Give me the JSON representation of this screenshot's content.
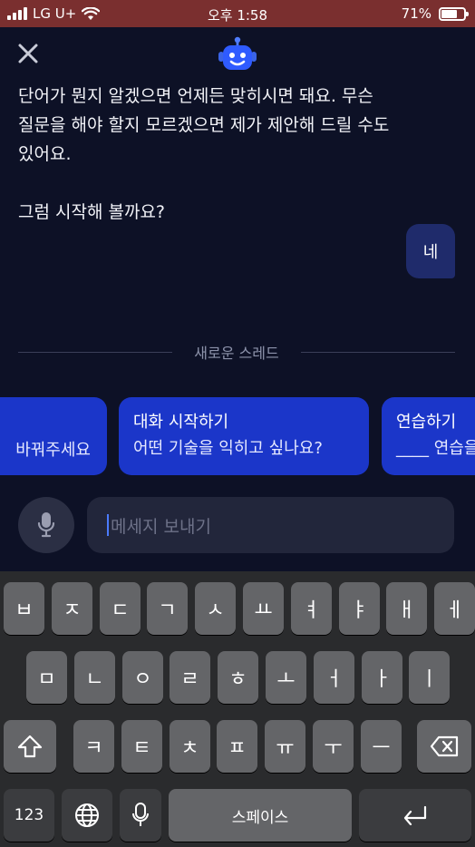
{
  "status_bar": {
    "carrier": "LG U+",
    "time": "오후 1:58",
    "battery_percent": "71%",
    "battery_level": 0.71
  },
  "header": {
    "close_icon": "close-icon",
    "logo_icon": "robot-logo-icon"
  },
  "chat": {
    "bot_message": "단어가 뭔지 알겠으면 언제든 맞히시면 돼요. 무슨\n질문을 해야 할지 모르겠으면 제가 제안해 드릴 수도\n있어요.\n\n그럼 시작해 볼까요?",
    "user_message": "네",
    "divider_label": "새로운 스레드"
  },
  "suggestions": [
    {
      "title": "",
      "body": "바꿔주세요"
    },
    {
      "title": "대화 시작하기",
      "body": "어떤 기술을 익히고 싶나요?"
    },
    {
      "title": "연습하기",
      "body": "____ 연습을"
    }
  ],
  "input": {
    "placeholder": "메세지 보내기",
    "mic_icon": "microphone-icon"
  },
  "keyboard": {
    "row1": [
      "ㅂ",
      "ㅈ",
      "ㄷ",
      "ㄱ",
      "ㅅ",
      "ㅛ",
      "ㅕ",
      "ㅑ",
      "ㅐ",
      "ㅔ"
    ],
    "row2": [
      "ㅁ",
      "ㄴ",
      "ㅇ",
      "ㄹ",
      "ㅎ",
      "ㅗ",
      "ㅓ",
      "ㅏ",
      "ㅣ"
    ],
    "row3": [
      "ㅋ",
      "ㅌ",
      "ㅊ",
      "ㅍ",
      "ㅠ",
      "ㅜ",
      "ㅡ"
    ],
    "numbers_key": "123",
    "space_key": "스페이스",
    "shift_icon": "shift-icon",
    "delete_icon": "backspace-icon",
    "globe_icon": "globe-icon",
    "dictation_icon": "microphone-icon",
    "return_icon": "return-icon"
  },
  "colors": {
    "background": "#0d1126",
    "status_bar": "#7a2f2f",
    "accent": "#1b36c9",
    "user_bubble": "#1f2b6b"
  }
}
